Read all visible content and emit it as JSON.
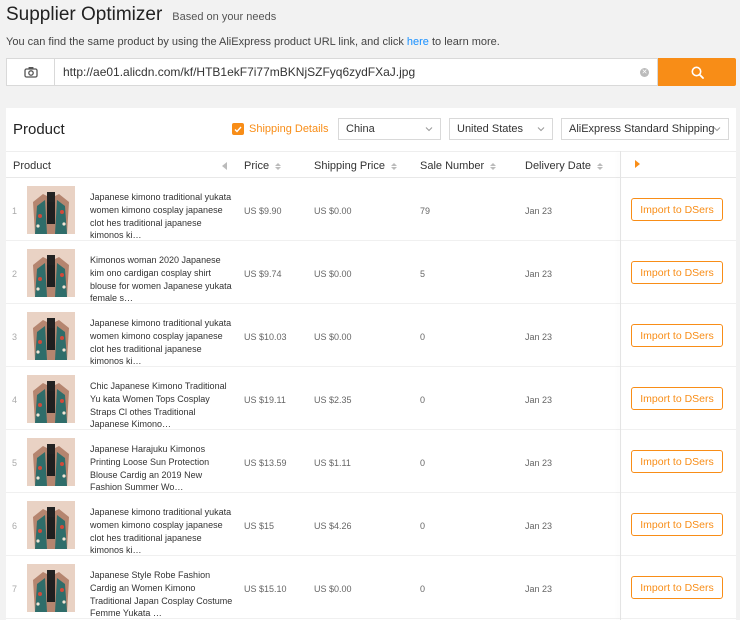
{
  "header": {
    "title": "Supplier Optimizer",
    "subtitle": "Based on your needs",
    "desc_prefix": "You can find the same product by using the AliExpress product URL link, and click ",
    "desc_link": "here",
    "desc_suffix": " to learn more."
  },
  "search": {
    "url": "http://ae01.alicdn.com/kf/HTB1ekF7i77mBKNjSZFyq6zydFXaJ.jpg",
    "camera_icon": "camera-icon",
    "clear_icon": "clear-icon",
    "search_icon": "search-icon"
  },
  "panel": {
    "title": "Product",
    "shipping_details_label": "Shipping Details",
    "shipping_details_checked": true,
    "ship_from": "China",
    "ship_to": "United States",
    "shipping_method": "AliExpress Standard Shipping"
  },
  "table": {
    "columns": [
      "Product",
      "Price",
      "Shipping Price",
      "Sale Number",
      "Delivery Date"
    ],
    "rows": [
      {
        "index": "1",
        "name": "Japanese kimono traditional yukata women kimono cosplay japanese clot hes traditional japanese kimonos ki…",
        "price": "US $9.90",
        "shipping": "US $0.00",
        "sales": "79",
        "delivery": "Jan 23",
        "action": "Import to DSers"
      },
      {
        "index": "2",
        "name": "Kimonos woman 2020 Japanese kim ono cardigan cosplay shirt blouse for women Japanese yukata female s…",
        "price": "US $9.74",
        "shipping": "US $0.00",
        "sales": "5",
        "delivery": "Jan 23",
        "action": "Import to DSers"
      },
      {
        "index": "3",
        "name": "Japanese kimono traditional yukata women kimono cosplay japanese clot hes traditional japanese kimonos ki…",
        "price": "US $10.03",
        "shipping": "US $0.00",
        "sales": "0",
        "delivery": "Jan 23",
        "action": "Import to DSers"
      },
      {
        "index": "4",
        "name": "Chic Japanese Kimono Traditional Yu kata Women Tops Cosplay Straps Cl othes Traditional Japanese Kimono…",
        "price": "US $19.11",
        "shipping": "US $2.35",
        "sales": "0",
        "delivery": "Jan 23",
        "action": "Import to DSers"
      },
      {
        "index": "5",
        "name": "Japanese Harajuku Kimonos Printing Loose Sun Protection Blouse Cardig an 2019 New Fashion Summer Wo…",
        "price": "US $13.59",
        "shipping": "US $1.11",
        "sales": "0",
        "delivery": "Jan 23",
        "action": "Import to DSers"
      },
      {
        "index": "6",
        "name": "Japanese kimono traditional yukata women kimono cosplay japanese clot hes traditional japanese kimonos ki…",
        "price": "US $15",
        "shipping": "US $4.26",
        "sales": "0",
        "delivery": "Jan 23",
        "action": "Import to DSers"
      },
      {
        "index": "7",
        "name": "Japanese Style Robe Fashion Cardig an Women Kimono Traditional Japan Cosplay Costume Femme Yukata …",
        "price": "US $15.10",
        "shipping": "US $0.00",
        "sales": "0",
        "delivery": "Jan 23",
        "action": "Import to DSers"
      }
    ]
  },
  "colors": {
    "accent": "#f88d17",
    "link": "#1890ff"
  }
}
